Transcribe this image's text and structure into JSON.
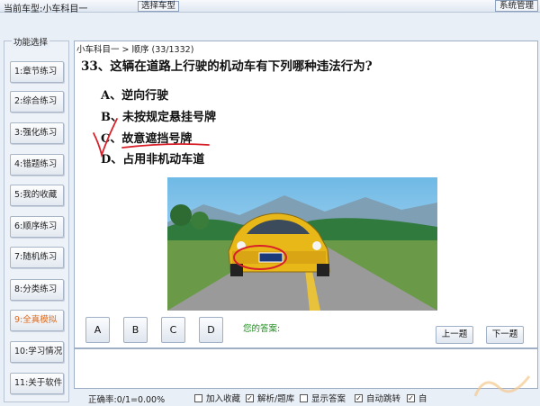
{
  "topbar": {
    "current_car": "当前车型:小车科目一",
    "select_car": "选择车型",
    "system_manage": "系统管理"
  },
  "sidebar": {
    "title": "功能选择",
    "items": [
      {
        "label": "1:章节练习"
      },
      {
        "label": "2:综合练习"
      },
      {
        "label": "3:强化练习"
      },
      {
        "label": "4:错题练习"
      },
      {
        "label": "5:我的收藏"
      },
      {
        "label": "6:顺序练习"
      },
      {
        "label": "7:随机练习"
      },
      {
        "label": "8:分类练习"
      },
      {
        "label": "9:全真模拟"
      },
      {
        "label": "10:学习情况"
      },
      {
        "label": "11:关于软件"
      }
    ],
    "active_index": 8,
    "active_color": "#e06a1a"
  },
  "breadcrumb": "小车科目一 > 顺序 (33/1332)",
  "question": {
    "text": "33、这辆在道路上行驶的机动车有下列哪种违法行为?",
    "options": [
      {
        "label": "A、逆向行驶"
      },
      {
        "label": "B、未按规定悬挂号牌"
      },
      {
        "label": "C、故意遮挡号牌"
      },
      {
        "label": "D、占用非机动车道"
      }
    ],
    "marked_answer": "C",
    "mark_color": "#d8202a"
  },
  "answers": {
    "buttons": [
      "A",
      "B",
      "C",
      "D"
    ],
    "your_answer_label": "您的答案:",
    "your_answer_color": "#1a8a1a"
  },
  "nav": {
    "prev": "上一题",
    "next": "下一题"
  },
  "footer": {
    "accuracy": "正确率:0/1=0.00%",
    "checkboxes": [
      {
        "label": "加入收藏",
        "checked": false
      },
      {
        "label": "解析/题库",
        "checked": true
      },
      {
        "label": "显示答案",
        "checked": false
      },
      {
        "label": "自动跳转",
        "checked": true
      },
      {
        "label": "自",
        "checked": true
      }
    ]
  }
}
